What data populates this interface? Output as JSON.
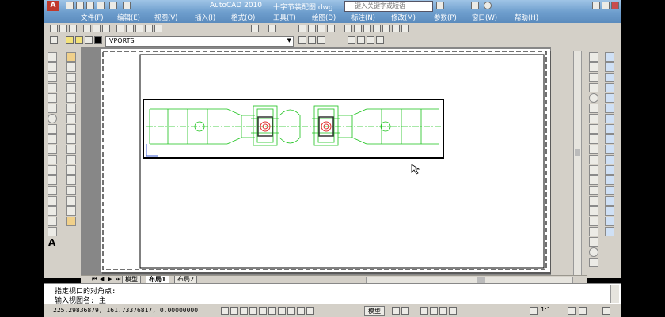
{
  "titlebar": {
    "app_title": "AutoCAD 2010",
    "file_name": "十字节装配图.dwg",
    "search_placeholder": "键入关键字或短语"
  },
  "menu": {
    "items": [
      "文件(F)",
      "编辑(E)",
      "视图(V)",
      "插入(I)",
      "格式(O)",
      "工具(T)",
      "绘图(D)",
      "标注(N)",
      "修改(M)",
      "参数(P)",
      "窗口(W)",
      "帮助(H)"
    ]
  },
  "layers": {
    "current_layer": "VPORTS"
  },
  "layout_tabs": {
    "tabs": [
      "模型",
      "布局1",
      "布局2"
    ]
  },
  "command_line": {
    "history_line": "指定视口的对角点:",
    "prompt_line": "输入视图名: 主"
  },
  "status": {
    "coordinates": "225.29836879, 161.73376817, 0.00000000",
    "model_button": "模型",
    "scale": "1:1"
  },
  "colors": {
    "drawing_green": "#19c219",
    "highlight_red": "#e23030",
    "titlebar_blue": "#6f9fce"
  }
}
